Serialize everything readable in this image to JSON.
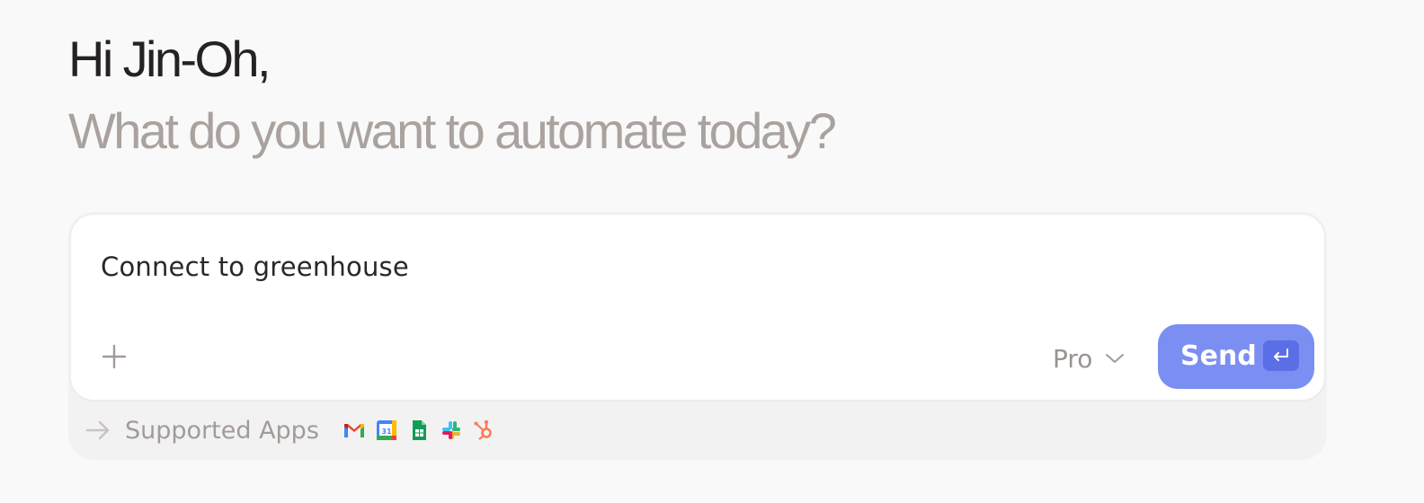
{
  "header": {
    "greeting": "Hi Jin-Oh,",
    "subtitle": "What do you want to automate today?"
  },
  "composer": {
    "prompt_value": "Connect to greenhouse",
    "add_icon": "plus-icon",
    "model": {
      "selected": "Pro",
      "icon": "chevron-down-icon"
    },
    "send": {
      "label": "Send",
      "icon": "enter-key-icon"
    }
  },
  "supported_apps": {
    "label": "Supported Apps",
    "icon": "arrow-right-icon",
    "apps": [
      "gmail-icon",
      "google-calendar-icon",
      "google-sheets-icon",
      "slack-icon",
      "hubspot-icon"
    ],
    "calendar_day": "31"
  },
  "colors": {
    "accent": "#7b8ff2",
    "accent_dark": "#5a6fe6",
    "text_primary": "#262223",
    "text_muted": "#aaa29e",
    "background": "#f9f9f9"
  }
}
